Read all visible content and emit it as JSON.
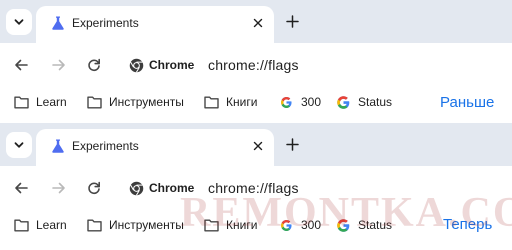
{
  "browsers": [
    {
      "tab": {
        "title": "Experiments"
      },
      "address": {
        "site_chip": "Chrome",
        "url": "chrome://flags"
      },
      "bookmarks": {
        "items": [
          {
            "label": "Learn",
            "icon": "folder-icon"
          },
          {
            "label": "Инструменты",
            "icon": "folder-icon"
          },
          {
            "label": "Книги",
            "icon": "folder-icon"
          },
          {
            "label": "300",
            "icon": "google-g-icon"
          },
          {
            "label": "Status",
            "icon": "google-g-icon"
          }
        ]
      },
      "compare_label": "Раньше"
    },
    {
      "tab": {
        "title": "Experiments"
      },
      "address": {
        "site_chip": "Chrome",
        "url": "chrome://flags"
      },
      "bookmarks": {
        "items": [
          {
            "label": "Learn",
            "icon": "folder-icon"
          },
          {
            "label": "Инструменты",
            "icon": "folder-icon"
          },
          {
            "label": "Книги",
            "icon": "folder-icon"
          },
          {
            "label": "300",
            "icon": "google-g-icon"
          },
          {
            "label": "Status",
            "icon": "google-g-icon"
          }
        ]
      },
      "compare_label": "Теперь"
    }
  ],
  "watermark": "REMONTKA.COM",
  "colors": {
    "tabstrip": "#e3e8f0",
    "accent": "#1a73e8",
    "icon": "#474747",
    "flask": "#4f6df0"
  }
}
